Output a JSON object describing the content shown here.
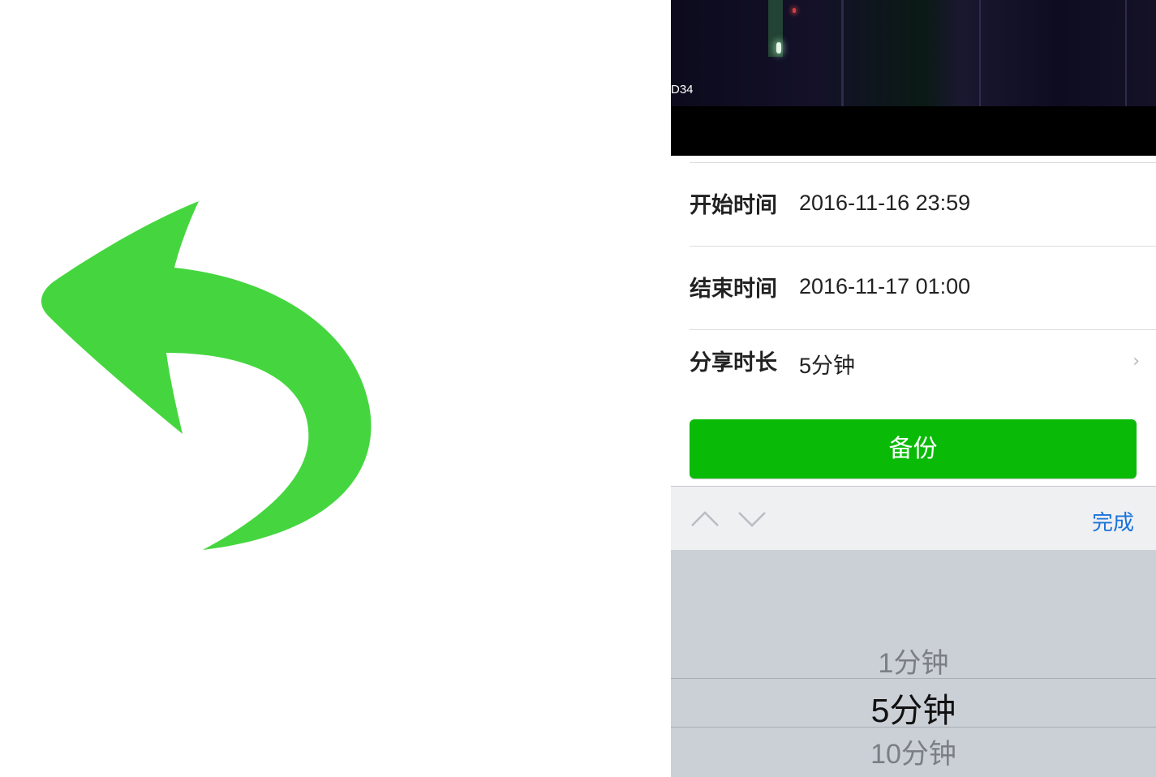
{
  "video": {
    "label": "D34"
  },
  "form": {
    "rows": [
      {
        "label": "开始时间",
        "value": "2016-11-16 23:59"
      },
      {
        "label": "结束时间",
        "value": "2016-11-17 01:00"
      },
      {
        "label": "分享时长",
        "value": "5分钟",
        "icon": "chevron-right-icon"
      }
    ]
  },
  "backup_button": {
    "label": "备份"
  },
  "toolbar": {
    "prev_icon": "chevron-up-icon",
    "next_icon": "chevron-down-icon",
    "done_label": "完成"
  },
  "picker": {
    "options": [
      "1分钟",
      "5分钟",
      "10分钟"
    ],
    "selected": "5分钟"
  },
  "colors": {
    "arrow_green": "#45d63f",
    "button_green": "#09bb07",
    "done_blue": "#1a73d9",
    "picker_bg": "#cbcfd6"
  }
}
